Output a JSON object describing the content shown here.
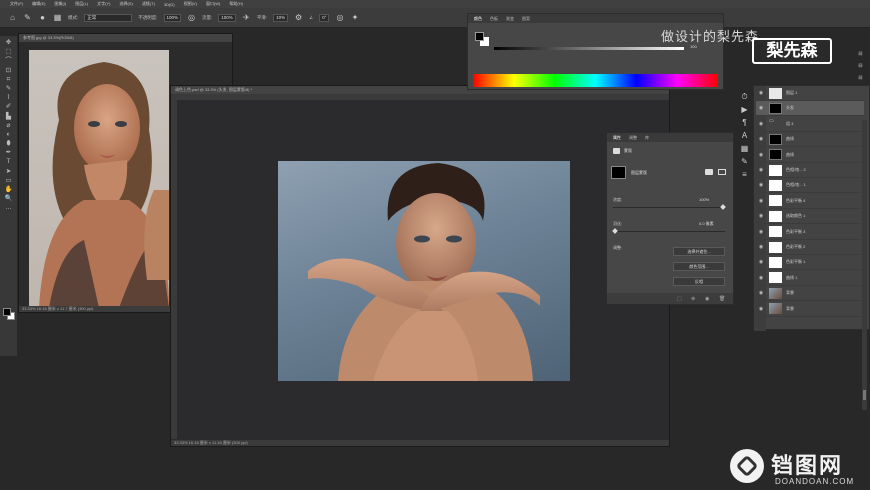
{
  "menu": [
    "文件(F)",
    "编辑(E)",
    "图像(I)",
    "图层(L)",
    "文字(Y)",
    "选择(S)",
    "滤镜(T)",
    "3D(D)",
    "视图(V)",
    "窗口(W)",
    "帮助(H)"
  ],
  "options": {
    "mode_label": "模式:",
    "mode_value": "正常",
    "opacity_label": "不透明度:",
    "opacity_value": "100%",
    "flow_label": "流量:",
    "flow_value": "100%",
    "smooth_label": "平滑:",
    "smooth_value": "10%",
    "angle_value": "0°"
  },
  "tools": [
    "✥",
    "⬚",
    "⌒",
    "⊡",
    "⌗",
    "✎",
    "⌇",
    "✐",
    "▙",
    "⌀",
    "◐",
    "⬮",
    "✒",
    "T",
    "➤",
    "▭",
    "✋",
    "🔍",
    "…"
  ],
  "doc_ref": {
    "tab": "参考图.jpg @ 33.3%(RGB/8)",
    "status": "33.33%   16.16 厘米 x 11.7 厘米 (300 ppi)"
  },
  "doc_main": {
    "tab": "调色上色.psd @ 33.3% (头发, 图层蒙版/8) *",
    "status": "33.33%   16.16 厘米 x 11.16 厘米 (300 ppi)"
  },
  "color_panel": {
    "tabs": [
      "颜色",
      "色板",
      "渐变",
      "图案"
    ],
    "slider_value": "100"
  },
  "properties_panel": {
    "tabs": [
      "属性",
      "调整",
      "库"
    ],
    "section": "蒙版",
    "mask_label": "图层蒙版",
    "density_label": "浓度:",
    "density_value": "100%",
    "feather_label": "羽化:",
    "feather_value": "0.0 像素",
    "refine_label": "调整:",
    "buttons": [
      "选择并遮住...",
      "颜色范围...",
      "反相"
    ]
  },
  "layers": [
    {
      "name": "图层 1",
      "thumb": "light"
    },
    {
      "name": "头发",
      "thumb": "dark"
    },
    {
      "name": "组 3",
      "thumb": "group"
    },
    {
      "name": "曲线",
      "thumb": "dark"
    },
    {
      "name": "曲线",
      "thumb": "dark"
    },
    {
      "name": "色相/饱... 2",
      "thumb": "white"
    },
    {
      "name": "色相/饱... 1",
      "thumb": "white"
    },
    {
      "name": "色彩平衡 4",
      "thumb": "white"
    },
    {
      "name": "选取颜色 1",
      "thumb": "white"
    },
    {
      "name": "色彩平衡 3",
      "thumb": "white"
    },
    {
      "name": "色彩平衡 2",
      "thumb": "white"
    },
    {
      "name": "色彩平衡 1",
      "thumb": "white"
    },
    {
      "name": "曲线 1",
      "thumb": "white"
    },
    {
      "name": "背景",
      "thumb": "photo"
    },
    {
      "name": "背景",
      "thumb": "photo"
    }
  ],
  "watermark": {
    "tagline": "做设计的梨先森",
    "logo": "梨先森",
    "brand": "铛图网",
    "domain": "DOANDOAN.COM"
  },
  "colors": {
    "bg": "#282828",
    "panel": "#474747",
    "accent": "#1f8fff"
  }
}
